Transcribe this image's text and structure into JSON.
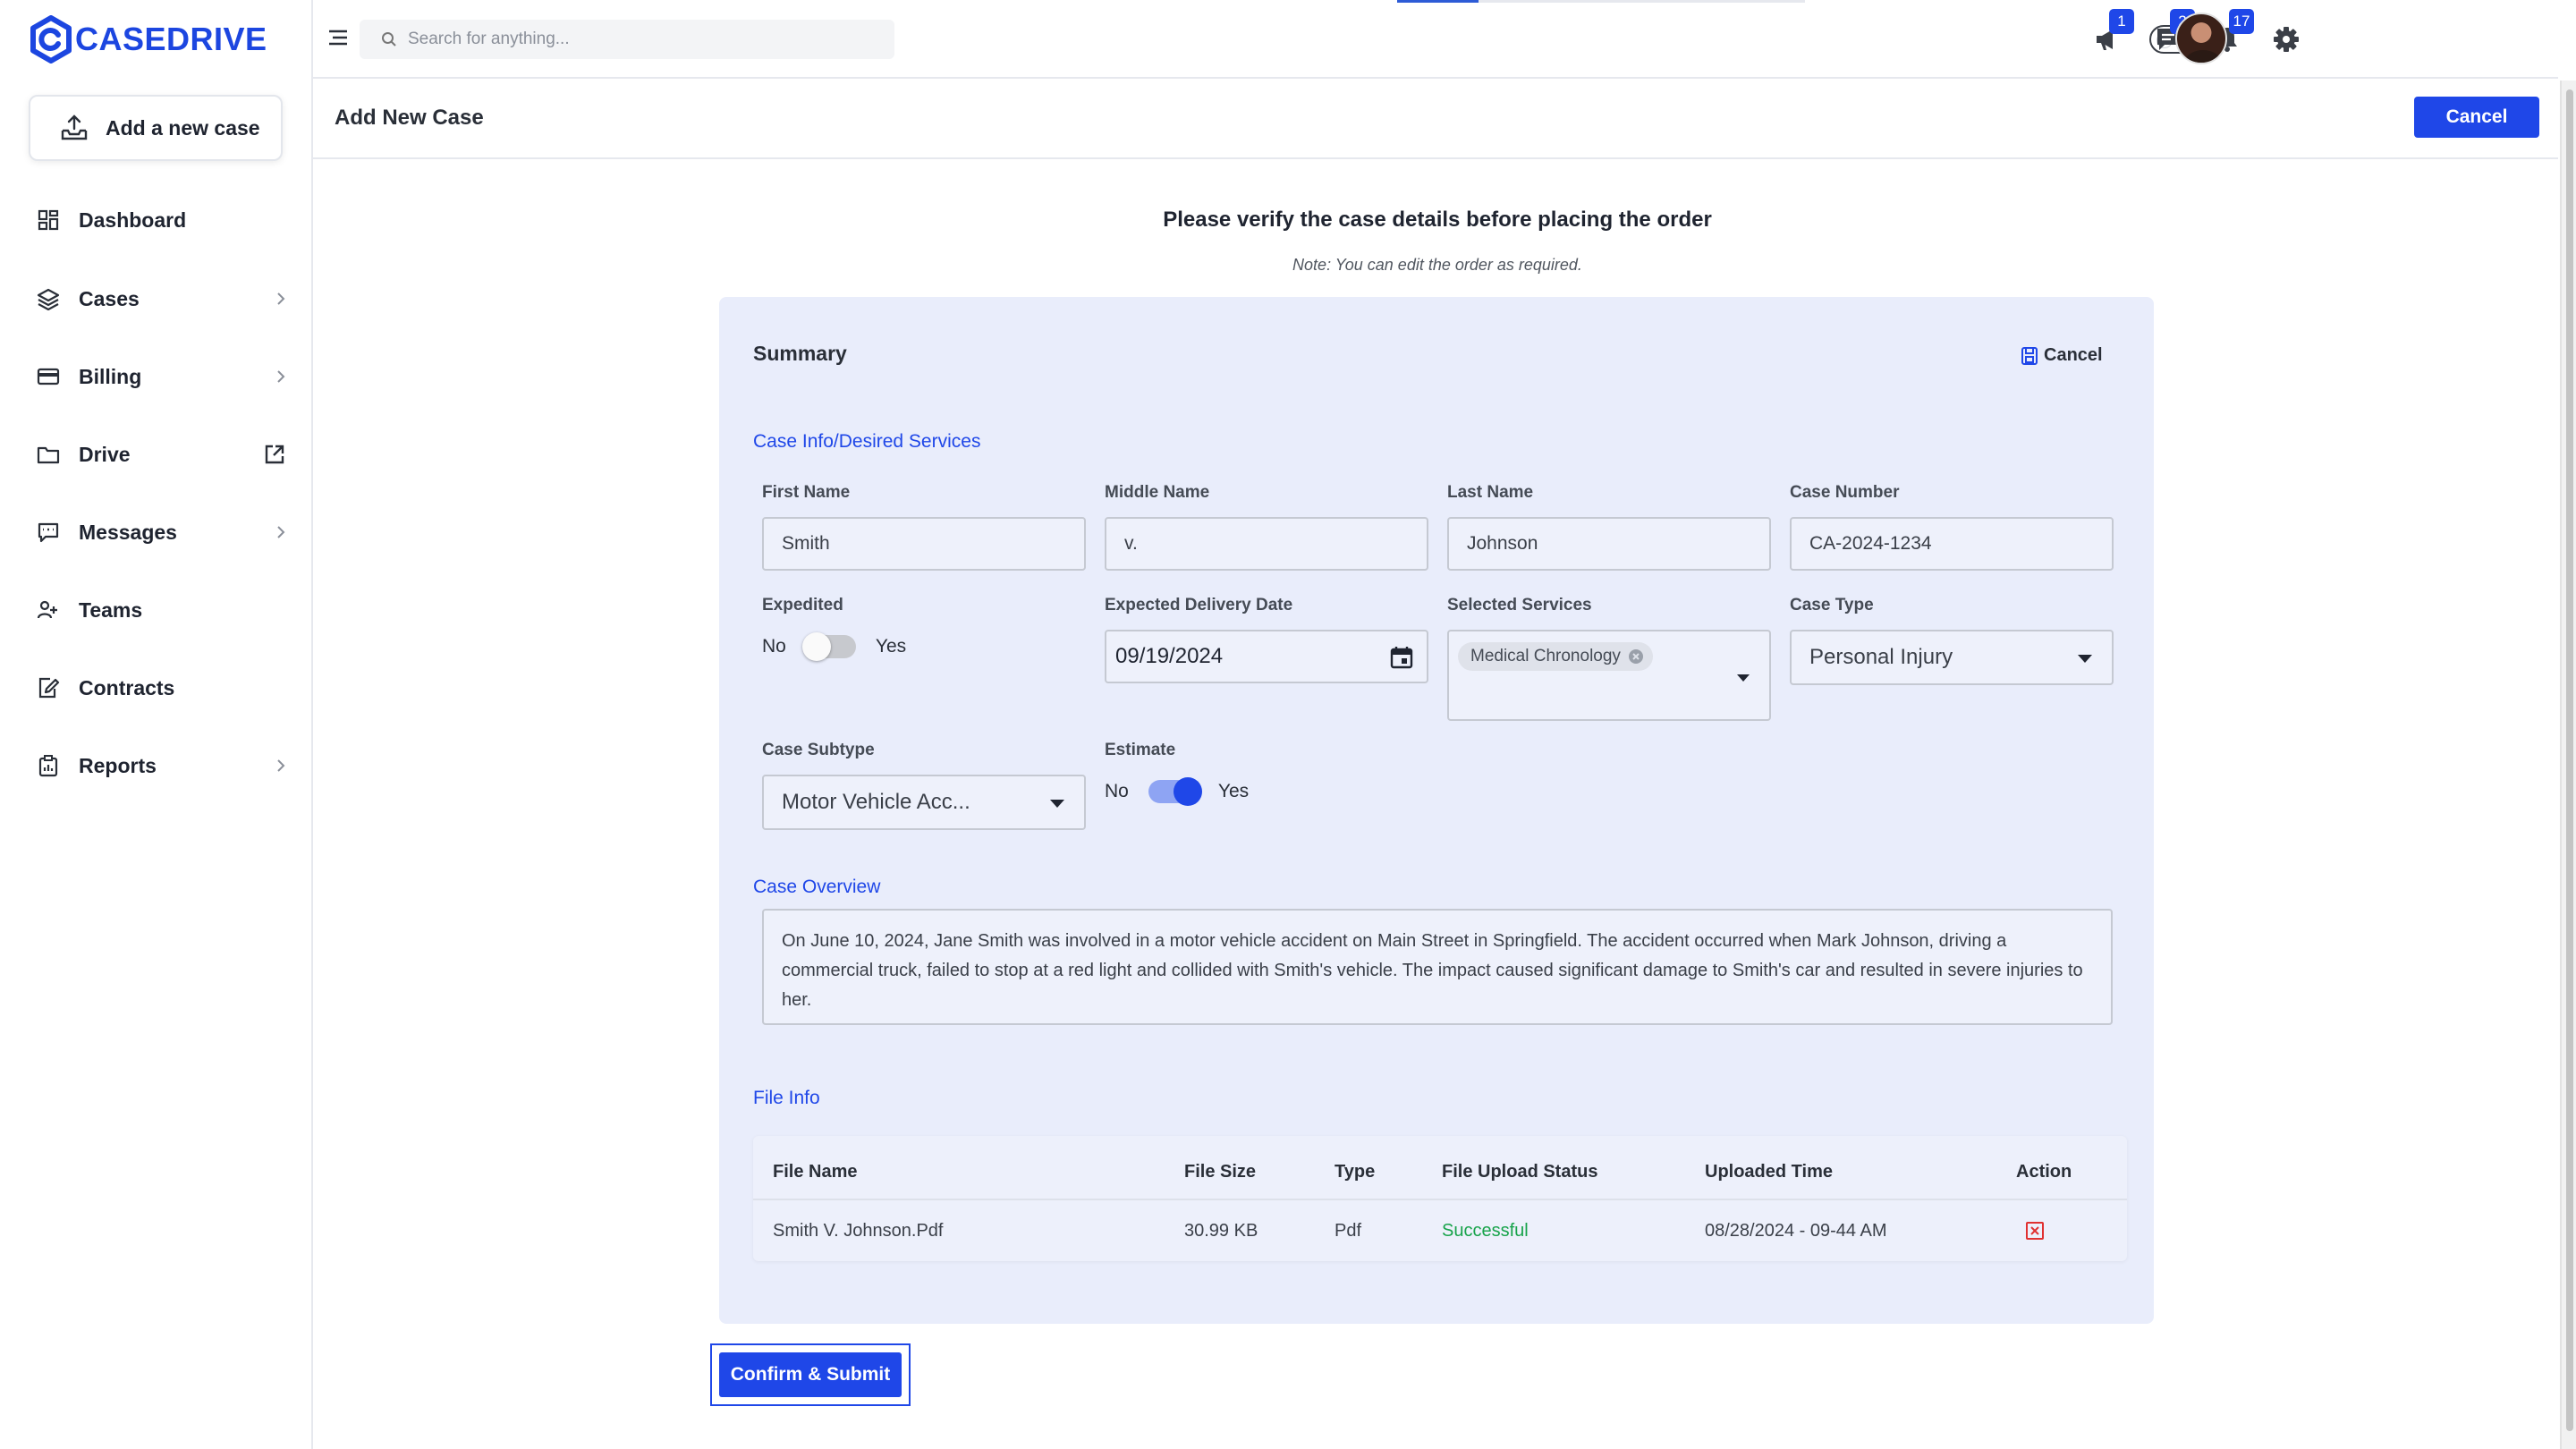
{
  "brand": {
    "name": "CASEDRIVE",
    "color": "#1c46e0"
  },
  "sidebar": {
    "add_case_label": "Add a new case",
    "items": [
      {
        "label": "Dashboard",
        "icon": "dashboard-grid-icon"
      },
      {
        "label": "Cases",
        "icon": "layers-icon"
      },
      {
        "label": "Billing",
        "icon": "credit-card-icon"
      },
      {
        "label": "Drive",
        "icon": "folder-icon"
      },
      {
        "label": "Messages",
        "icon": "message-icon"
      },
      {
        "label": "Teams",
        "icon": "users-icon"
      },
      {
        "label": "Contracts",
        "icon": "contract-edit-icon"
      },
      {
        "label": "Reports",
        "icon": "clipboard-report-icon"
      }
    ]
  },
  "topbar": {
    "search_placeholder": "Search for anything...",
    "load_progress": 0.2,
    "badges": {
      "announcements": "1",
      "chat": "2",
      "notifications": "17"
    }
  },
  "header": {
    "title": "Add New Case",
    "cancel_label": "Cancel"
  },
  "verify": {
    "title": "Please verify the case details before placing the order",
    "note": "Note: You can edit the order as required."
  },
  "summary": {
    "title": "Summary",
    "cancel_label": "Cancel",
    "case_info_title": "Case Info/Desired Services",
    "fields": {
      "first_name": {
        "label": "First Name",
        "value": "Smith"
      },
      "middle_name": {
        "label": "Middle Name",
        "value": "v."
      },
      "last_name": {
        "label": "Last Name",
        "value": "Johnson"
      },
      "case_number": {
        "label": "Case Number",
        "value": "CA-2024-1234"
      },
      "expedited": {
        "label": "Expedited",
        "no": "No",
        "yes": "Yes",
        "on": false
      },
      "delivery_date": {
        "label": "Expected Delivery Date",
        "value": "09/19/2024"
      },
      "services": {
        "label": "Selected Services",
        "chips": [
          "Medical Chronology"
        ]
      },
      "case_type": {
        "label": "Case Type",
        "value": "Personal Injury"
      },
      "case_subtype": {
        "label": "Case Subtype",
        "value": "Motor Vehicle Acc..."
      },
      "estimate": {
        "label": "Estimate",
        "no": "No",
        "yes": "Yes",
        "on": true
      }
    },
    "overview_title": "Case Overview",
    "overview_text": "On June 10, 2024, Jane Smith was involved in a motor vehicle accident on Main Street in Springfield. The accident occurred when Mark Johnson, driving a commercial truck, failed to stop at a red light and collided with Smith's vehicle. The impact caused significant damage to Smith's car and resulted in severe injuries to her.",
    "file_info_title": "File Info",
    "file_table": {
      "headers": [
        "File Name",
        "File Size",
        "Type",
        "File Upload Status",
        "Uploaded Time",
        "Action"
      ],
      "rows": [
        {
          "name": "Smith V. Johnson.Pdf",
          "size": "30.99 KB",
          "type": "Pdf",
          "status": "Successful",
          "time": "08/28/2024 - 09-44 AM"
        }
      ]
    }
  },
  "confirm_label": "Confirm & Submit",
  "colors": {
    "accent": "#1f47e8",
    "success": "#17a34a",
    "card_bg": "#e9edfb",
    "danger": "#e03131"
  }
}
